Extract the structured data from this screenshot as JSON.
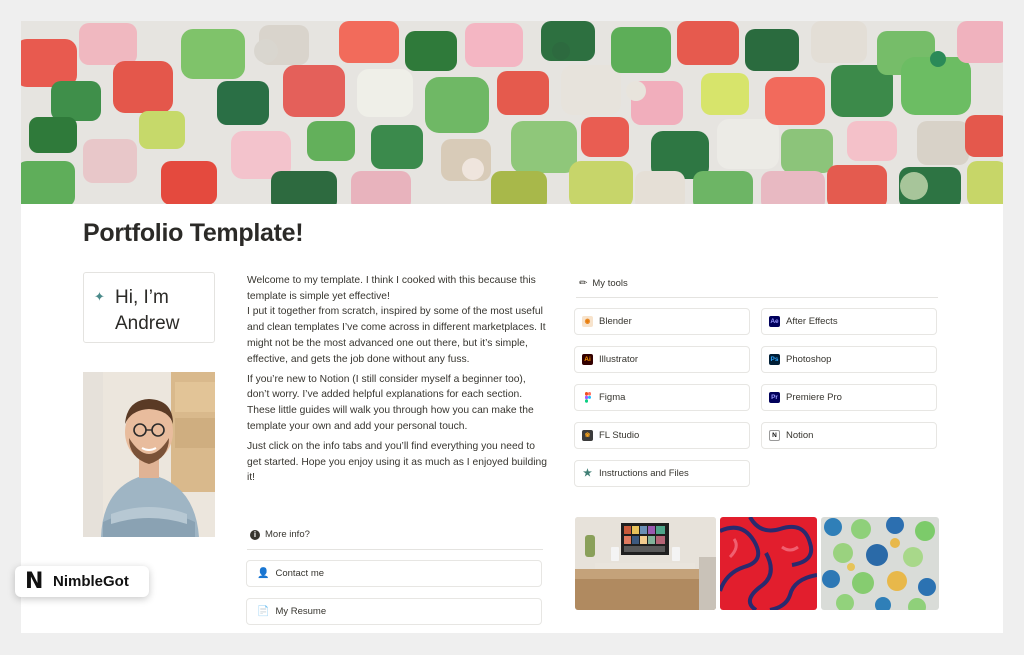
{
  "page": {
    "title": "Portfolio Template!"
  },
  "hero": {
    "greeting": "Hi, I’m Andrew",
    "sparkle_icon": "sparkle-icon"
  },
  "intro": {
    "paragraphs": [
      "Welcome to my template. I think I cooked with this because this template is simple yet effective!",
      "I put it together from scratch, inspired by some of the most useful and clean templates I’ve come across in different marketplaces. It might not be the most advanced one out there, but it’s simple, effective, and gets the job done without any fuss.",
      "If you’re new to Notion (I still consider myself a beginner too), don’t worry. I’ve added helpful explanations for each section. These little guides will walk you through how you can make the template your own and add your personal touch.",
      "Just click on the info tabs and you’ll find everything you need to get started. Hope you enjoy using it as much as I enjoyed building it!"
    ],
    "more_info": "More info?"
  },
  "links": {
    "contact": "Contact me",
    "resume": "My Resume"
  },
  "tools": {
    "heading": "My tools",
    "items": [
      {
        "label": "Blender",
        "icon": "blender-icon",
        "color": "#e87d0d"
      },
      {
        "label": "After Effects",
        "icon": "after-effects-icon",
        "abbr": "Ae",
        "color": "#00005b",
        "fg": "#9999ff"
      },
      {
        "label": "Illustrator",
        "icon": "illustrator-icon",
        "abbr": "Ai",
        "color": "#330000",
        "fg": "#ff9a00"
      },
      {
        "label": "Photoshop",
        "icon": "photoshop-icon",
        "abbr": "Ps",
        "color": "#001e36",
        "fg": "#31a8ff"
      },
      {
        "label": "Figma",
        "icon": "figma-icon",
        "color": "#f24e1e"
      },
      {
        "label": "Premiere Pro",
        "icon": "premiere-pro-icon",
        "abbr": "Pr",
        "color": "#00005b",
        "fg": "#9999ff"
      },
      {
        "label": "FL Studio",
        "icon": "fl-studio-icon",
        "color": "#3b3b3b"
      },
      {
        "label": "Notion",
        "icon": "notion-icon",
        "abbr": "N",
        "color": "#ffffff",
        "fg": "#111111"
      },
      {
        "label": "Instructions and Files",
        "icon": "star-icon",
        "color": "#3f7e74"
      }
    ]
  },
  "brand": {
    "name": "NimbleGot",
    "logo_letter": "N"
  }
}
